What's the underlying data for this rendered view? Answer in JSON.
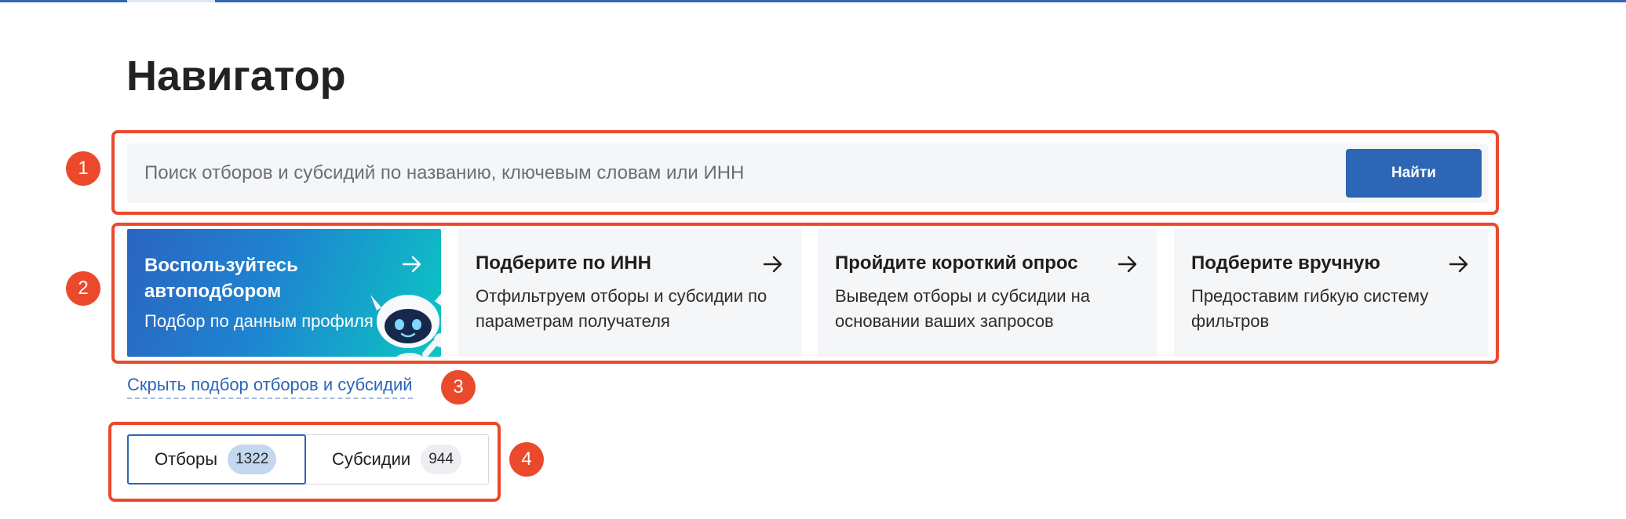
{
  "page": {
    "title": "Навигатор"
  },
  "search": {
    "placeholder": "Поиск отборов и субсидий по названию, ключевым словам или ИНН",
    "button_label": "Найти"
  },
  "cards": [
    {
      "title": "Воспользуйтесь автоподбором",
      "text": "Подбор по данным профиля"
    },
    {
      "title": "Подберите по ИНН",
      "text": "Отфильтруем отборы и субсидии по параметрам получателя"
    },
    {
      "title": "Пройдите короткий опрос",
      "text": "Выведем отборы и субсидии на основании ваших запросов"
    },
    {
      "title": "Подберите вручную",
      "text": "Предоставим гибкую систему фильтров"
    }
  ],
  "hide_link": "Скрыть подбор отборов и субсидий",
  "tabs": [
    {
      "label": "Отборы",
      "count": "1322",
      "active": true
    },
    {
      "label": "Субсидии",
      "count": "944",
      "active": false
    }
  ],
  "annotations": [
    "1",
    "2",
    "3",
    "4"
  ],
  "colors": {
    "accent": "#2c66b5",
    "annotation": "#ea4a2b"
  }
}
